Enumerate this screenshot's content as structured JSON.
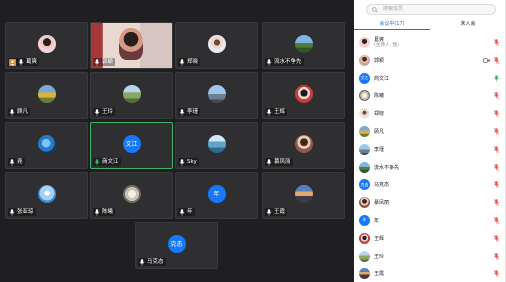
{
  "colors": {
    "accent": "#1a73e8",
    "speaking": "#3fb36a",
    "muted": "#e15858",
    "avatar_blue": "#1677ff"
  },
  "tiles": [
    {
      "name": "葛爽",
      "pin": true,
      "avatar": "photo-woman-pink"
    },
    {
      "name": "郭颖",
      "video": true
    },
    {
      "name": "郑晓",
      "avatar": "photo-doll"
    },
    {
      "name": "流水不争先",
      "avatar": "photo-landscape"
    },
    {
      "name": "顾凡",
      "avatar": "photo-landscape-yellow"
    },
    {
      "name": "王玲",
      "avatar": "photo-field"
    },
    {
      "name": "李瑾",
      "avatar": "photo-city"
    },
    {
      "name": "王辉",
      "avatar": "photo-anime"
    },
    {
      "name": "尧",
      "avatar": "photo-earth"
    },
    {
      "name": "商文江",
      "avatar_text": "文江",
      "active": true
    },
    {
      "name": "Sky",
      "avatar": "photo-water"
    },
    {
      "name": "慕凤丽",
      "avatar": "photo-portrait"
    },
    {
      "name": "张亚琼",
      "avatar": "photo-blue-sky"
    },
    {
      "name": "陈曦",
      "avatar": "photo-moon"
    },
    {
      "name": "年",
      "avatar_text": "年"
    },
    {
      "name": "王霞",
      "avatar": "photo-sunset"
    },
    {
      "name": "马克态",
      "avatar_text": "克态"
    }
  ],
  "panel": {
    "search_placeholder": "搜索成员",
    "tabs": [
      "会议中(17)",
      "未入会"
    ],
    "participants": [
      {
        "name": "葛爽",
        "sub": "(主持人, 我)",
        "avatar": "photo-woman-pink"
      },
      {
        "name": "郭颖",
        "avatar": "photo-woman",
        "video_icon": true
      },
      {
        "name": "商文江",
        "avatar_text": "文江",
        "speaking": true
      },
      {
        "name": "陈曦",
        "avatar": "photo-moon"
      },
      {
        "name": "郑晓",
        "avatar": "photo-doll"
      },
      {
        "name": "顾凡",
        "avatar": "photo-landscape-yellow"
      },
      {
        "name": "李瑾",
        "avatar": "photo-city"
      },
      {
        "name": "流水不争先",
        "avatar": "photo-landscape"
      },
      {
        "name": "马克态",
        "avatar_text": "克态"
      },
      {
        "name": "慕凤丽",
        "avatar": "photo-portrait"
      },
      {
        "name": "年",
        "avatar_text": "年"
      },
      {
        "name": "王辉",
        "avatar": "photo-anime"
      },
      {
        "name": "王玲",
        "avatar": "photo-field"
      },
      {
        "name": "王霞",
        "avatar": "photo-sunset"
      }
    ]
  }
}
